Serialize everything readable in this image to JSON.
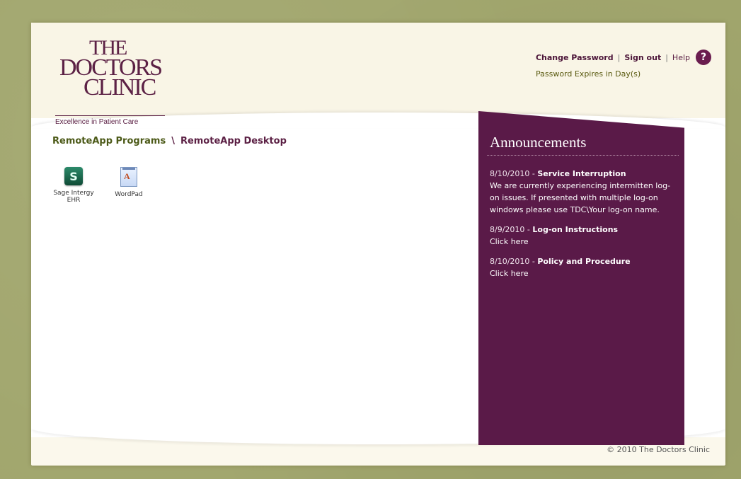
{
  "header": {
    "logo": {
      "line1": "THE",
      "line2": "DOCTORS",
      "line3": "CLINIC",
      "tagline": "Excellence in Patient Care"
    },
    "links": {
      "change_password": "Change Password",
      "sep1": "|",
      "sign_out": "Sign out",
      "sep2": "|",
      "help": "Help",
      "help_icon_glyph": "?",
      "password_expires": "Password Expires in Day(s)"
    }
  },
  "breadcrumb": {
    "programs": "RemoteApp Programs",
    "separator": "\\",
    "desktop": "RemoteApp Desktop"
  },
  "apps": [
    {
      "label": "Sage Intergy EHR",
      "icon": "sage-stethoscope-icon"
    },
    {
      "label": "WordPad",
      "icon": "wordpad-icon"
    }
  ],
  "announcements": {
    "title": "Announcements",
    "items": [
      {
        "date": "8/10/2010 -",
        "title": "Service Interruption",
        "body": "We are currently experiencing intermitten log-on issues.  If presented with multiple log-on windows please use TDC\\Your log-on name."
      },
      {
        "date": "8/9/2010 -",
        "title": "Log-on Instructions",
        "link": "Click here"
      },
      {
        "date": "8/10/2010 -",
        "title": "Policy and Procedure",
        "link": "Click here"
      }
    ]
  },
  "footer": {
    "copyright": "© 2010 The Doctors Clinic"
  },
  "colors": {
    "brand_plum": "#5a1a48",
    "olive_link": "#4c5a18",
    "page_bg": "#a1a66d"
  }
}
